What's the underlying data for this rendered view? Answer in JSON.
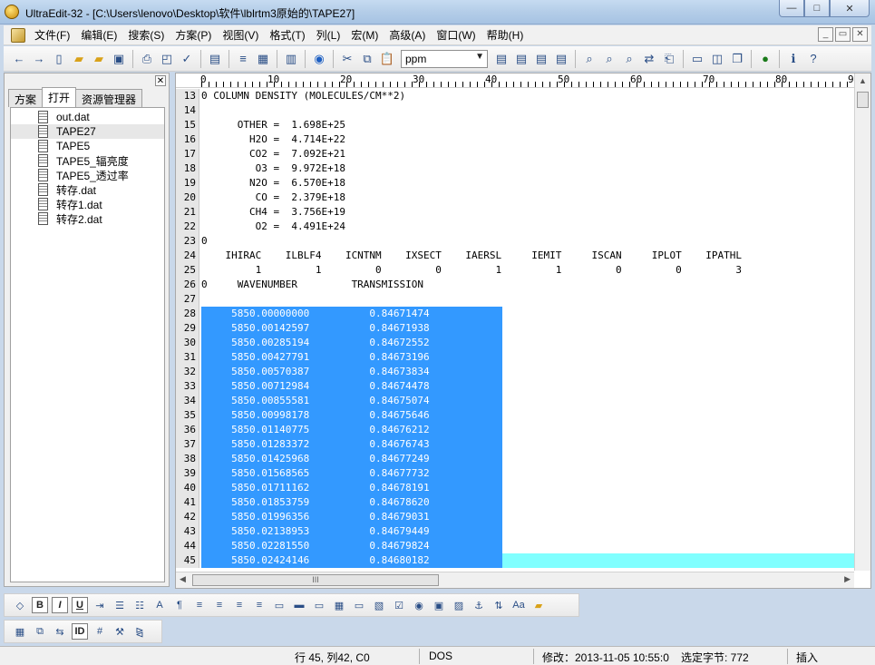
{
  "window": {
    "title": "UltraEdit-32 - [C:\\Users\\lenovo\\Desktop\\软件\\lblrtm3原始的\\TAPE27]",
    "buttons": {
      "minimize": "—",
      "maximize": "□",
      "close": "✕"
    }
  },
  "menu": {
    "items": [
      "文件(F)",
      "编辑(E)",
      "搜索(S)",
      "方案(P)",
      "视图(V)",
      "格式(T)",
      "列(L)",
      "宏(M)",
      "高级(A)",
      "窗口(W)",
      "帮助(H)"
    ],
    "mdi_buttons": {
      "minimize": "_",
      "restore": "▭",
      "close": "✕"
    }
  },
  "toolbar": {
    "icons": [
      "back-icon",
      "forward-icon",
      "new-file-icon",
      "open-folder-icon",
      "open-icon",
      "save-icon",
      "print-icon",
      "print-preview-icon",
      "spell-check-icon",
      "page-icon",
      "word-wrap-icon",
      "hex-icon",
      "column-icon",
      "browser-icon",
      "cut-icon",
      "copy-icon",
      "paste-icon"
    ],
    "combo_value": "ppm",
    "icons_right": [
      "align-left-icon",
      "align-center-icon",
      "align-right-icon",
      "justify-icon",
      "find-icon",
      "find-next-icon",
      "find-prev-icon",
      "replace-icon",
      "find-in-files-icon",
      "split-horizontal-icon",
      "split-vertical-icon",
      "cascade-icon",
      "web-icon",
      "info-icon",
      "help-icon"
    ]
  },
  "left_panel": {
    "close": "✕",
    "tabs": [
      "方案",
      "打开",
      "资源管理器"
    ],
    "active_tab": "打开",
    "files": [
      "out.dat",
      "TAPE27",
      "TAPE5",
      "TAPE5_辐亮度",
      "TAPE5_透过率",
      "转存.dat",
      "转存1.dat",
      "转存2.dat"
    ],
    "selected_file": "TAPE27"
  },
  "editor": {
    "ruler_labels": [
      "0",
      "10",
      "20",
      "30",
      "40",
      "50",
      "60",
      "70",
      "80",
      "9"
    ],
    "lines": [
      {
        "num": "13",
        "text": "0 COLUMN DENSITY (MOLECULES/CM**2)"
      },
      {
        "num": "14",
        "text": ""
      },
      {
        "num": "15",
        "text": "      OTHER =  1.698E+25"
      },
      {
        "num": "16",
        "text": "        H2O =  4.714E+22"
      },
      {
        "num": "17",
        "text": "        CO2 =  7.092E+21"
      },
      {
        "num": "18",
        "text": "         O3 =  9.972E+18"
      },
      {
        "num": "19",
        "text": "        N2O =  6.570E+18"
      },
      {
        "num": "20",
        "text": "         CO =  2.379E+18"
      },
      {
        "num": "21",
        "text": "        CH4 =  3.756E+19"
      },
      {
        "num": "22",
        "text": "         O2 =  4.491E+24"
      },
      {
        "num": "23",
        "text": "0"
      },
      {
        "num": "24",
        "text": "    IHIRAC    ILBLF4    ICNTNM    IXSECT    IAERSL     IEMIT     ISCAN     IPLOT    IPATHL"
      },
      {
        "num": "25",
        "text": "         1         1         0         0         1         1         0         0         3"
      },
      {
        "num": "26",
        "text": "0     WAVENUMBER         TRANSMISSION"
      },
      {
        "num": "27",
        "text": ""
      }
    ],
    "selected_lines": [
      {
        "num": "28",
        "text": "     5850.00000000          0.84671474"
      },
      {
        "num": "29",
        "text": "     5850.00142597          0.84671938"
      },
      {
        "num": "30",
        "text": "     5850.00285194          0.84672552"
      },
      {
        "num": "31",
        "text": "     5850.00427791          0.84673196"
      },
      {
        "num": "32",
        "text": "     5850.00570387          0.84673834"
      },
      {
        "num": "33",
        "text": "     5850.00712984          0.84674478"
      },
      {
        "num": "34",
        "text": "     5850.00855581          0.84675074"
      },
      {
        "num": "35",
        "text": "     5850.00998178          0.84675646"
      },
      {
        "num": "36",
        "text": "     5850.01140775          0.84676212"
      },
      {
        "num": "37",
        "text": "     5850.01283372          0.84676743"
      },
      {
        "num": "38",
        "text": "     5850.01425968          0.84677249"
      },
      {
        "num": "39",
        "text": "     5850.01568565          0.84677732"
      },
      {
        "num": "40",
        "text": "     5850.01711162          0.84678191"
      },
      {
        "num": "41",
        "text": "     5850.01853759          0.84678620"
      },
      {
        "num": "42",
        "text": "     5850.01996356          0.84679031"
      },
      {
        "num": "43",
        "text": "     5850.02138953          0.84679449"
      },
      {
        "num": "44",
        "text": "     5850.02281550          0.84679824"
      },
      {
        "num": "45",
        "text": "     5850.02424146          0.84680182"
      }
    ],
    "hscroll_thumb": "III",
    "selection_color": "#3399ff",
    "current_line_color": "#80ffff"
  },
  "bottom_toolbar_1": [
    "html-icon",
    "B",
    "I",
    "U",
    "indent-icon",
    "bullet-list-icon",
    "numbered-list-icon",
    "font-color-icon",
    "paragraph-icon",
    "align-left-icon",
    "align-center-icon",
    "align-right-icon",
    "align-justify-icon",
    "form-icon",
    "hr-icon",
    "textbox-icon",
    "table-icon",
    "input-icon",
    "image-icon",
    "checkbox-icon",
    "radio-icon",
    "frame-icon",
    "picture-icon",
    "anchor-icon",
    "sort-icon",
    "case-icon",
    "folder-icon"
  ],
  "bottom_toolbar_2": [
    "grid-icon",
    "copy-icon",
    "convert-icon",
    "ID",
    "number-icon",
    "tools-icon",
    "compare-icon"
  ],
  "status": {
    "position": "行 45, 列42, C0",
    "format": "DOS",
    "modified": "修改：2013-11-05 10:55:0",
    "selected_bytes": "选定字节: 772",
    "mode": "插入"
  }
}
